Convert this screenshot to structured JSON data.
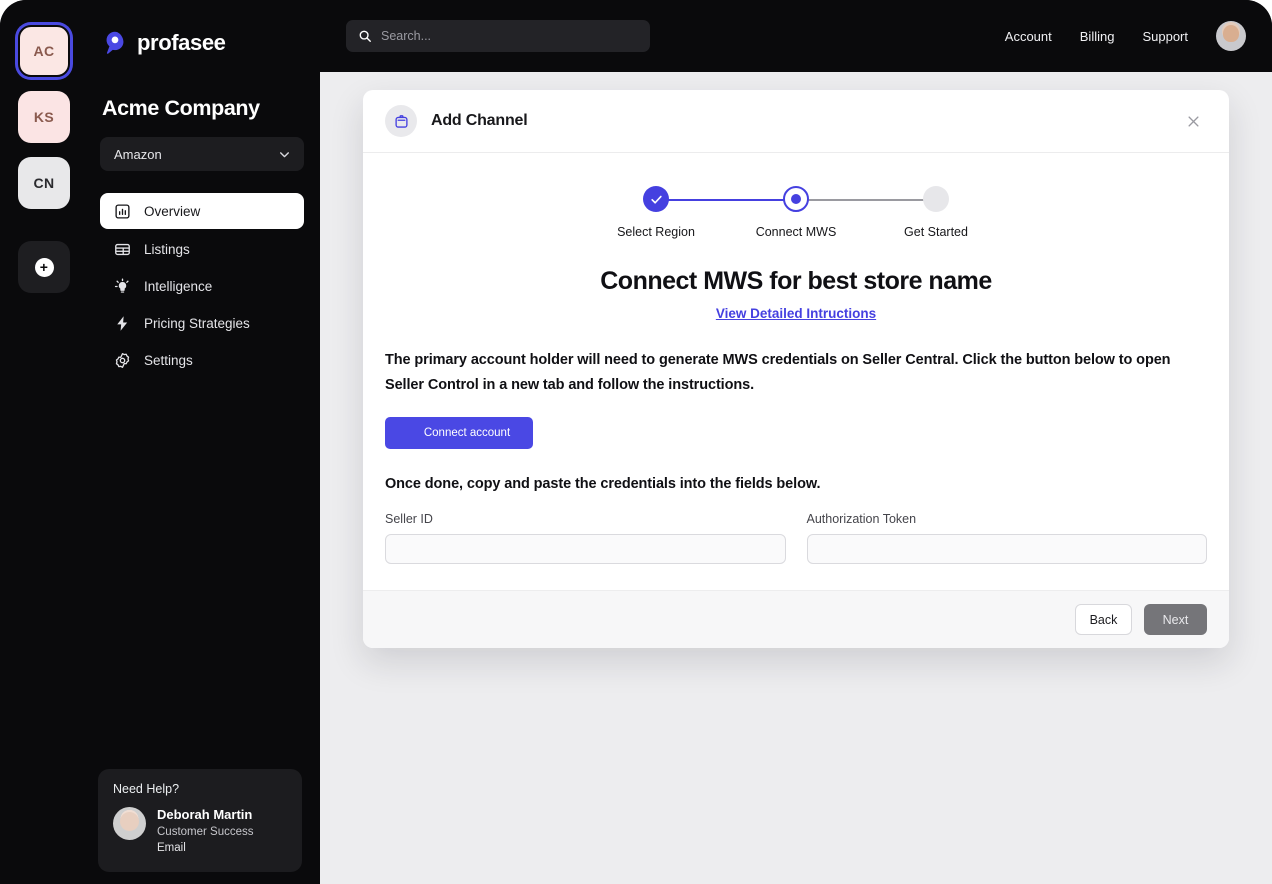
{
  "workspaces": [
    {
      "initials": "AC",
      "state": "active"
    },
    {
      "initials": "KS",
      "state": "pink"
    },
    {
      "initials": "CN",
      "state": "gray"
    }
  ],
  "add_workspace": {
    "name": "add-workspace-button",
    "glyph": "+"
  },
  "brand": {
    "name": "profasee",
    "icon": "location-pin-icon"
  },
  "sidebar": {
    "company": "Acme Company",
    "channel_select": {
      "value": "Amazon",
      "icon": "chevron-down-icon"
    },
    "items": [
      {
        "label": "Overview",
        "icon": "bar-chart-icon",
        "active": true
      },
      {
        "label": "Listings",
        "icon": "table-icon",
        "active": false
      },
      {
        "label": "Intelligence",
        "icon": "lightbulb-icon",
        "active": false
      },
      {
        "label": "Pricing Strategies",
        "icon": "lightning-bolt-icon",
        "active": false
      },
      {
        "label": "Settings",
        "icon": "gear-icon",
        "active": false
      }
    ],
    "help": {
      "title": "Need Help?",
      "name": "Deborah Martin",
      "role": "Customer Success",
      "action": "Email"
    }
  },
  "topbar": {
    "search_placeholder": "Search...",
    "search_value": "",
    "search_icon": "search-icon",
    "links": [
      "Account",
      "Billing",
      "Support"
    ],
    "avatar": "user-avatar"
  },
  "modal": {
    "title": "Add Channel",
    "title_icon": "briefcase-icon",
    "close_icon": "close-icon",
    "steps": [
      {
        "label": "Select Region",
        "state": "done"
      },
      {
        "label": "Connect MWS",
        "state": "current"
      },
      {
        "label": "Get Started",
        "state": "todo"
      }
    ],
    "heading": "Connect MWS for best store name",
    "instructions_link": "View Detailed Intructions",
    "paragraph": "The primary account holder will need to generate MWS credentials on Seller Central. Click the button below to open Seller Control in a new tab and follow the instructions.",
    "connect_button": "Connect account",
    "paragraph2": "Once done, copy and paste the credentials into the fields below.",
    "fields": [
      {
        "label": "Seller ID",
        "value": "",
        "placeholder": ""
      },
      {
        "label": "Authorization Token",
        "value": "",
        "placeholder": ""
      }
    ],
    "footer": {
      "back": "Back",
      "next": "Next"
    }
  },
  "colors": {
    "accent": "#4540e0",
    "sidebar_bg": "#0a0a0c",
    "canvas_bg": "#ededef",
    "modal_footer_bg": "#f7f7f8",
    "workspace_pink": "#fbe4e4",
    "workspace_pink_text": "#8a5a4e",
    "next_disabled": "#757579"
  }
}
